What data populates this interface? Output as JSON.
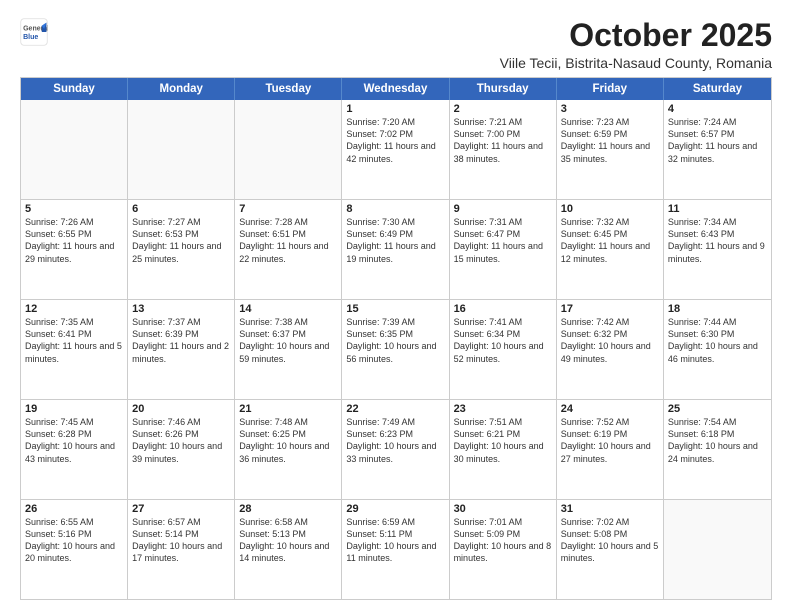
{
  "header": {
    "logo_general": "General",
    "logo_blue": "Blue",
    "month_title": "October 2025",
    "subtitle": "Viile Tecii, Bistrita-Nasaud County, Romania"
  },
  "days_of_week": [
    "Sunday",
    "Monday",
    "Tuesday",
    "Wednesday",
    "Thursday",
    "Friday",
    "Saturday"
  ],
  "rows": [
    [
      {
        "day": "",
        "text": "",
        "empty": true
      },
      {
        "day": "",
        "text": "",
        "empty": true
      },
      {
        "day": "",
        "text": "",
        "empty": true
      },
      {
        "day": "1",
        "text": "Sunrise: 7:20 AM\nSunset: 7:02 PM\nDaylight: 11 hours and 42 minutes."
      },
      {
        "day": "2",
        "text": "Sunrise: 7:21 AM\nSunset: 7:00 PM\nDaylight: 11 hours and 38 minutes."
      },
      {
        "day": "3",
        "text": "Sunrise: 7:23 AM\nSunset: 6:59 PM\nDaylight: 11 hours and 35 minutes."
      },
      {
        "day": "4",
        "text": "Sunrise: 7:24 AM\nSunset: 6:57 PM\nDaylight: 11 hours and 32 minutes."
      }
    ],
    [
      {
        "day": "5",
        "text": "Sunrise: 7:26 AM\nSunset: 6:55 PM\nDaylight: 11 hours and 29 minutes."
      },
      {
        "day": "6",
        "text": "Sunrise: 7:27 AM\nSunset: 6:53 PM\nDaylight: 11 hours and 25 minutes."
      },
      {
        "day": "7",
        "text": "Sunrise: 7:28 AM\nSunset: 6:51 PM\nDaylight: 11 hours and 22 minutes."
      },
      {
        "day": "8",
        "text": "Sunrise: 7:30 AM\nSunset: 6:49 PM\nDaylight: 11 hours and 19 minutes."
      },
      {
        "day": "9",
        "text": "Sunrise: 7:31 AM\nSunset: 6:47 PM\nDaylight: 11 hours and 15 minutes."
      },
      {
        "day": "10",
        "text": "Sunrise: 7:32 AM\nSunset: 6:45 PM\nDaylight: 11 hours and 12 minutes."
      },
      {
        "day": "11",
        "text": "Sunrise: 7:34 AM\nSunset: 6:43 PM\nDaylight: 11 hours and 9 minutes."
      }
    ],
    [
      {
        "day": "12",
        "text": "Sunrise: 7:35 AM\nSunset: 6:41 PM\nDaylight: 11 hours and 5 minutes."
      },
      {
        "day": "13",
        "text": "Sunrise: 7:37 AM\nSunset: 6:39 PM\nDaylight: 11 hours and 2 minutes."
      },
      {
        "day": "14",
        "text": "Sunrise: 7:38 AM\nSunset: 6:37 PM\nDaylight: 10 hours and 59 minutes."
      },
      {
        "day": "15",
        "text": "Sunrise: 7:39 AM\nSunset: 6:35 PM\nDaylight: 10 hours and 56 minutes."
      },
      {
        "day": "16",
        "text": "Sunrise: 7:41 AM\nSunset: 6:34 PM\nDaylight: 10 hours and 52 minutes."
      },
      {
        "day": "17",
        "text": "Sunrise: 7:42 AM\nSunset: 6:32 PM\nDaylight: 10 hours and 49 minutes."
      },
      {
        "day": "18",
        "text": "Sunrise: 7:44 AM\nSunset: 6:30 PM\nDaylight: 10 hours and 46 minutes."
      }
    ],
    [
      {
        "day": "19",
        "text": "Sunrise: 7:45 AM\nSunset: 6:28 PM\nDaylight: 10 hours and 43 minutes."
      },
      {
        "day": "20",
        "text": "Sunrise: 7:46 AM\nSunset: 6:26 PM\nDaylight: 10 hours and 39 minutes."
      },
      {
        "day": "21",
        "text": "Sunrise: 7:48 AM\nSunset: 6:25 PM\nDaylight: 10 hours and 36 minutes."
      },
      {
        "day": "22",
        "text": "Sunrise: 7:49 AM\nSunset: 6:23 PM\nDaylight: 10 hours and 33 minutes."
      },
      {
        "day": "23",
        "text": "Sunrise: 7:51 AM\nSunset: 6:21 PM\nDaylight: 10 hours and 30 minutes."
      },
      {
        "day": "24",
        "text": "Sunrise: 7:52 AM\nSunset: 6:19 PM\nDaylight: 10 hours and 27 minutes."
      },
      {
        "day": "25",
        "text": "Sunrise: 7:54 AM\nSunset: 6:18 PM\nDaylight: 10 hours and 24 minutes."
      }
    ],
    [
      {
        "day": "26",
        "text": "Sunrise: 6:55 AM\nSunset: 5:16 PM\nDaylight: 10 hours and 20 minutes."
      },
      {
        "day": "27",
        "text": "Sunrise: 6:57 AM\nSunset: 5:14 PM\nDaylight: 10 hours and 17 minutes."
      },
      {
        "day": "28",
        "text": "Sunrise: 6:58 AM\nSunset: 5:13 PM\nDaylight: 10 hours and 14 minutes."
      },
      {
        "day": "29",
        "text": "Sunrise: 6:59 AM\nSunset: 5:11 PM\nDaylight: 10 hours and 11 minutes."
      },
      {
        "day": "30",
        "text": "Sunrise: 7:01 AM\nSunset: 5:09 PM\nDaylight: 10 hours and 8 minutes."
      },
      {
        "day": "31",
        "text": "Sunrise: 7:02 AM\nSunset: 5:08 PM\nDaylight: 10 hours and 5 minutes."
      },
      {
        "day": "",
        "text": "",
        "empty": true
      }
    ]
  ]
}
